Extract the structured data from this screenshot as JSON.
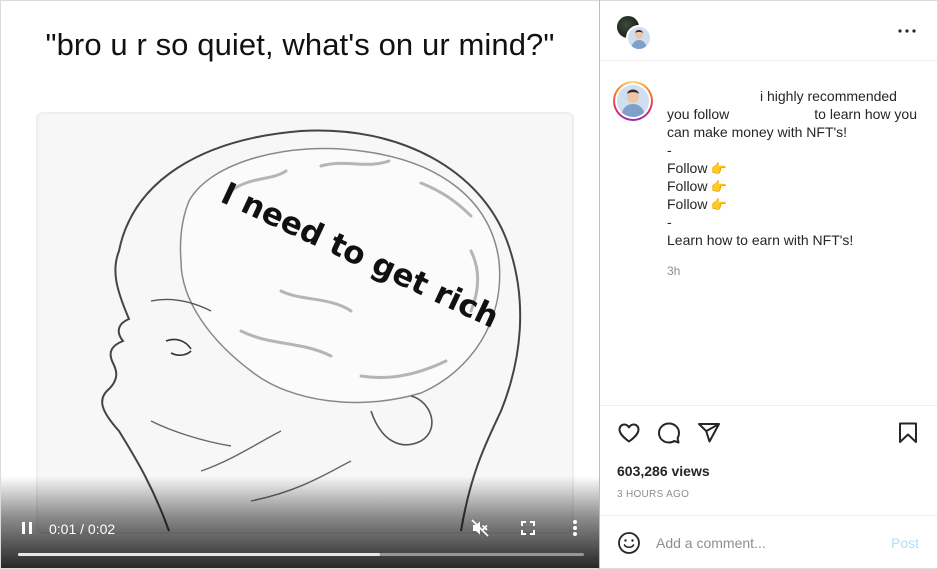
{
  "video": {
    "meme_caption": "\"bro u r so quiet, what's on ur mind?\"",
    "brain_text": "I need to get rich",
    "time_display": "0:01 / 0:02",
    "progress_fraction": 0.64,
    "icons": {
      "pause": "pause-icon",
      "mute": "volume-muted-icon",
      "fullscreen": "fullscreen-icon",
      "more": "more-vertical-icon"
    }
  },
  "header": {
    "more_icon": "more-horizontal-icon"
  },
  "caption": {
    "line1": "i highly recommended",
    "line2_start": "you follow",
    "line2_end": "to learn how you",
    "line3": "can make money with NFT's!",
    "dash": "-",
    "follow_label": "Follow",
    "point_emoji": "👉",
    "line_last": "Learn how to earn with NFT's!",
    "timestamp": "3h"
  },
  "actions": {
    "views": "603,286 views",
    "post_time": "3 HOURS AGO",
    "icons": {
      "like": "heart-icon",
      "comment": "comment-icon",
      "share": "send-icon",
      "save": "bookmark-icon"
    }
  },
  "comment": {
    "placeholder": "Add a comment...",
    "post_label": "Post",
    "emoji_icon": "smiley-icon",
    "post_color": "#b2dffc"
  },
  "colors": {
    "story_ring": [
      "#feda75",
      "#fa7e1e",
      "#d62976",
      "#962fbf"
    ],
    "muted_text": "#8e8e8e"
  }
}
